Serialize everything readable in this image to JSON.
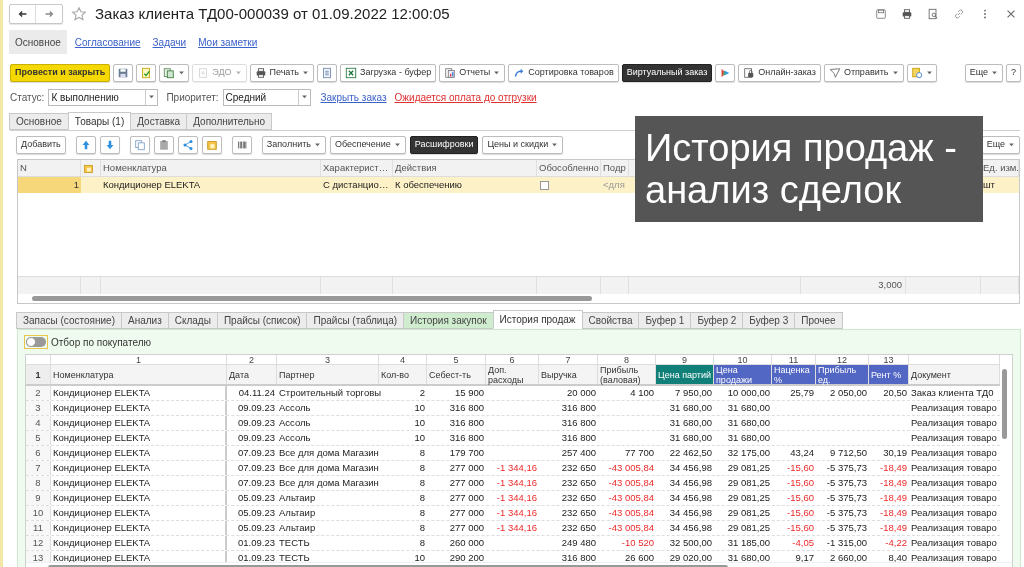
{
  "window": {
    "title": "Заказ клиента ТД00-000039 от 01.09.2022 12:00:05"
  },
  "nav_tabs": [
    {
      "label": "Основное",
      "selected": true
    },
    {
      "label": "Согласование",
      "selected": false
    },
    {
      "label": "Задачи",
      "selected": false
    },
    {
      "label": "Мои заметки",
      "selected": false
    }
  ],
  "command_bar": [
    {
      "kind": "primary",
      "label": "Провести и закрыть",
      "dropdown": false,
      "disabled": false
    },
    {
      "kind": "default",
      "dropdown": false,
      "disabled": false
    },
    {
      "kind": "default",
      "dropdown": false,
      "disabled": false
    },
    {
      "kind": "default",
      "dropdown": true,
      "disabled": false
    },
    {
      "kind": "default",
      "label": "ЭДО",
      "dropdown": true,
      "disabled": true
    },
    {
      "kind": "default",
      "label": "Печать",
      "dropdown": true,
      "disabled": false
    },
    {
      "kind": "default",
      "dropdown": false,
      "disabled": false
    },
    {
      "kind": "default",
      "label": "Загрузка - буфер",
      "dropdown": false,
      "disabled": false
    },
    {
      "kind": "default",
      "label": "Отчеты",
      "dropdown": true,
      "disabled": false
    },
    {
      "kind": "default",
      "label": "Сортировка товаров",
      "dropdown": false,
      "disabled": false
    },
    {
      "kind": "dark",
      "label": "Виртуальный заказ",
      "dropdown": false,
      "disabled": false
    },
    {
      "kind": "default",
      "dropdown": false,
      "disabled": false
    },
    {
      "kind": "default",
      "label": "Онлайн-заказ",
      "dropdown": false,
      "disabled": false
    },
    {
      "kind": "default",
      "label": "Отправить",
      "dropdown": true,
      "disabled": false
    },
    {
      "kind": "default",
      "dropdown": true,
      "disabled": false
    },
    {
      "kind": "default",
      "label": "Еще",
      "dropdown": true,
      "disabled": false
    },
    {
      "kind": "default",
      "label": "?",
      "dropdown": false,
      "disabled": false
    }
  ],
  "status": {
    "label": "Статус:",
    "value": "К выполнению"
  },
  "priority": {
    "label": "Приоритет:",
    "value": "Средний"
  },
  "links": [
    {
      "label": "Закрыть заказ",
      "kind": "normal"
    },
    {
      "label": "Ожидается оплата до отгрузки",
      "kind": "warning"
    }
  ],
  "page_tabs": [
    {
      "label": "Основное",
      "selected": false
    },
    {
      "label": "Товары (1)",
      "selected": true
    },
    {
      "label": "Доставка",
      "selected": false
    },
    {
      "label": "Дополнительно",
      "selected": false
    }
  ],
  "goods_toolbar": [
    {
      "kind": "default",
      "label": "Добавить",
      "dropdown": false
    },
    {
      "kind": "default",
      "dropdown": false
    },
    {
      "kind": "default",
      "dropdown": false
    },
    {
      "kind": "default",
      "dropdown": false
    },
    {
      "kind": "default",
      "dropdown": false
    },
    {
      "kind": "default",
      "dropdown": false
    },
    {
      "kind": "default",
      "dropdown": false
    },
    {
      "kind": "default",
      "dropdown": false
    },
    {
      "kind": "default",
      "label": "Заполнить",
      "dropdown": true
    },
    {
      "kind": "default",
      "label": "Обеспечение",
      "dropdown": true
    },
    {
      "kind": "dark",
      "label": "Расшифровки",
      "dropdown": false
    },
    {
      "kind": "default",
      "label": "Цены и скидки",
      "dropdown": true
    }
  ],
  "goods_more": "Еще",
  "goods_table": {
    "columns": [
      {
        "label": "N"
      },
      {
        "kind": "icon"
      },
      {
        "label": "Номенклатура"
      },
      {
        "label": "Характерист…"
      },
      {
        "label": "Действия"
      },
      {
        "label": "Обособленно"
      },
      {
        "label": "Подр"
      },
      {
        "label": "Ед. изм."
      }
    ],
    "rows": [
      {
        "selected": true,
        "number": "1",
        "item": "Кондиционер ELEKTA",
        "characteristic": "С дистанцио…",
        "action": "К обеспечению",
        "separate": false,
        "subdivision": "<для",
        "unit": "шт"
      }
    ],
    "footer_total": "3,000"
  },
  "caption": [
    "История продаж -",
    "анализ сделок"
  ],
  "bottom_tabs": [
    {
      "label": "Запасы (состояние)",
      "selected": false,
      "tinted": false
    },
    {
      "label": "Анализ",
      "selected": false,
      "tinted": false
    },
    {
      "label": "Склады",
      "selected": false,
      "tinted": false
    },
    {
      "label": "Прайсы (список)",
      "selected": false,
      "tinted": false
    },
    {
      "label": "Прайсы (таблица)",
      "selected": false,
      "tinted": false
    },
    {
      "label": "История закупок",
      "selected": false,
      "tinted": true
    },
    {
      "label": "История продаж",
      "selected": true,
      "tinted": false
    },
    {
      "label": "Свойства",
      "selected": false,
      "tinted": false
    },
    {
      "label": "Буфер 1",
      "selected": false,
      "tinted": false
    },
    {
      "label": "Буфер 2",
      "selected": false,
      "tinted": false
    },
    {
      "label": "Буфер 3",
      "selected": false,
      "tinted": false
    },
    {
      "label": "Прочее",
      "selected": false,
      "tinted": false
    }
  ],
  "filter": {
    "label": "Отбор по покупателю",
    "on": false
  },
  "sheet": {
    "column_numbers": [
      "1",
      "2",
      "3",
      "4",
      "5",
      "6",
      "7",
      "8",
      "9",
      "10",
      "11",
      "12",
      "13"
    ],
    "header_row": "1",
    "columns": [
      {
        "label": "Номенклатура"
      },
      {
        "label": "Дата"
      },
      {
        "label": "Партнер"
      },
      {
        "label": "Кол-во"
      },
      {
        "label": "Себест-ть"
      },
      {
        "label": "Доп. расходы"
      },
      {
        "label": "Выручка"
      },
      {
        "label": "Прибыль (валовая)"
      },
      {
        "label": "Цена партий",
        "color": "#0f7f78"
      },
      {
        "label": "Цена продажи",
        "color": "#5266c3"
      },
      {
        "label": "Наценка %",
        "color": "#5266c3"
      },
      {
        "label": "Прибыль ед.",
        "color": "#5266c3"
      },
      {
        "label": "Рент %",
        "color": "#5266c3"
      },
      {
        "label": "Документ"
      }
    ],
    "rows": [
      {
        "number": "2",
        "cells": [
          "Кондиционер ELEKTA",
          "04.11.24",
          "Строительный торговы",
          "2",
          "15 900",
          null,
          "20 000",
          "4 100",
          "7 950,00",
          "10 000,00",
          "25,79",
          "2 050,00",
          "20,50",
          "Заказ клиента ТД0"
        ]
      },
      {
        "number": "3",
        "cells": [
          "Кондиционер ELEKTA",
          "09.09.23",
          "Ассоль",
          "10",
          "316 800",
          null,
          "316 800",
          null,
          "31 680,00",
          "31 680,00",
          null,
          null,
          null,
          "Реализация товаро"
        ]
      },
      {
        "number": "4",
        "cells": [
          "Кондиционер ELEKTA",
          "09.09.23",
          "Ассоль",
          "10",
          "316 800",
          null,
          "316 800",
          null,
          "31 680,00",
          "31 680,00",
          null,
          null,
          null,
          "Реализация товаро"
        ]
      },
      {
        "number": "5",
        "cells": [
          "Кондиционер ELEKTA",
          "09.09.23",
          "Ассоль",
          "10",
          "316 800",
          null,
          "316 800",
          null,
          "31 680,00",
          "31 680,00",
          null,
          null,
          null,
          "Реализация товаро"
        ]
      },
      {
        "number": "6",
        "cells": [
          "Кондиционер ELEKTA",
          "07.09.23",
          "Все для дома Магазин",
          "8",
          "179 700",
          null,
          "257 400",
          "77 700",
          "22 462,50",
          "32 175,00",
          "43,24",
          "9 712,50",
          "30,19",
          "Реализация товаро"
        ]
      },
      {
        "number": "7",
        "cells": [
          "Кондиционер ELEKTA",
          "07.09.23",
          "Все для дома Магазин",
          "8",
          "277 000",
          {
            "text": "-1 344,16",
            "red": true
          },
          "232 650",
          {
            "text": "-43 005,84",
            "red": true
          },
          "34 456,98",
          "29 081,25",
          {
            "text": "-15,60",
            "red": true
          },
          "-5 375,73",
          {
            "text": "-18,49",
            "red": true
          },
          "Реализация товаро"
        ]
      },
      {
        "number": "8",
        "cells": [
          "Кондиционер ELEKTA",
          "07.09.23",
          "Все для дома Магазин",
          "8",
          "277 000",
          {
            "text": "-1 344,16",
            "red": true
          },
          "232 650",
          {
            "text": "-43 005,84",
            "red": true
          },
          "34 456,98",
          "29 081,25",
          {
            "text": "-15,60",
            "red": true
          },
          "-5 375,73",
          {
            "text": "-18,49",
            "red": true
          },
          "Реализация товаро"
        ]
      },
      {
        "number": "9",
        "cells": [
          "Кондиционер ELEKTA",
          "05.09.23",
          "Альтаир",
          "8",
          "277 000",
          {
            "text": "-1 344,16",
            "red": true
          },
          "232 650",
          {
            "text": "-43 005,84",
            "red": true
          },
          "34 456,98",
          "29 081,25",
          {
            "text": "-15,60",
            "red": true
          },
          "-5 375,73",
          {
            "text": "-18,49",
            "red": true
          },
          "Реализация товаро"
        ]
      },
      {
        "number": "10",
        "cells": [
          "Кондиционер ELEKTA",
          "05.09.23",
          "Альтаир",
          "8",
          "277 000",
          {
            "text": "-1 344,16",
            "red": true
          },
          "232 650",
          {
            "text": "-43 005,84",
            "red": true
          },
          "34 456,98",
          "29 081,25",
          {
            "text": "-15,60",
            "red": true
          },
          "-5 375,73",
          {
            "text": "-18,49",
            "red": true
          },
          "Реализация товаро"
        ]
      },
      {
        "number": "11",
        "cells": [
          "Кондиционер ELEKTA",
          "05.09.23",
          "Альтаир",
          "8",
          "277 000",
          {
            "text": "-1 344,16",
            "red": true
          },
          "232 650",
          {
            "text": "-43 005,84",
            "red": true
          },
          "34 456,98",
          "29 081,25",
          {
            "text": "-15,60",
            "red": true
          },
          "-5 375,73",
          {
            "text": "-18,49",
            "red": true
          },
          "Реализация товаро"
        ]
      },
      {
        "number": "12",
        "cells": [
          "Кондиционер ELEKTA",
          "01.09.23",
          "ТЕСТЬ",
          "8",
          "260 000",
          null,
          "249 480",
          {
            "text": "-10 520",
            "red": true
          },
          "32 500,00",
          "31 185,00",
          {
            "text": "-4,05",
            "red": true
          },
          "-1 315,00",
          {
            "text": "-4,22",
            "red": true
          },
          "Реализация товаро"
        ]
      },
      {
        "number": "13",
        "cells": [
          "Кондиционер ELEKTA",
          "01.09.23",
          "ТЕСТЬ",
          "10",
          "290 200",
          null,
          "316 800",
          "26 600",
          "29 020,00",
          "31 680,00",
          "9,17",
          "2 660,00",
          "8,40",
          "Реализация товаро"
        ]
      }
    ]
  }
}
